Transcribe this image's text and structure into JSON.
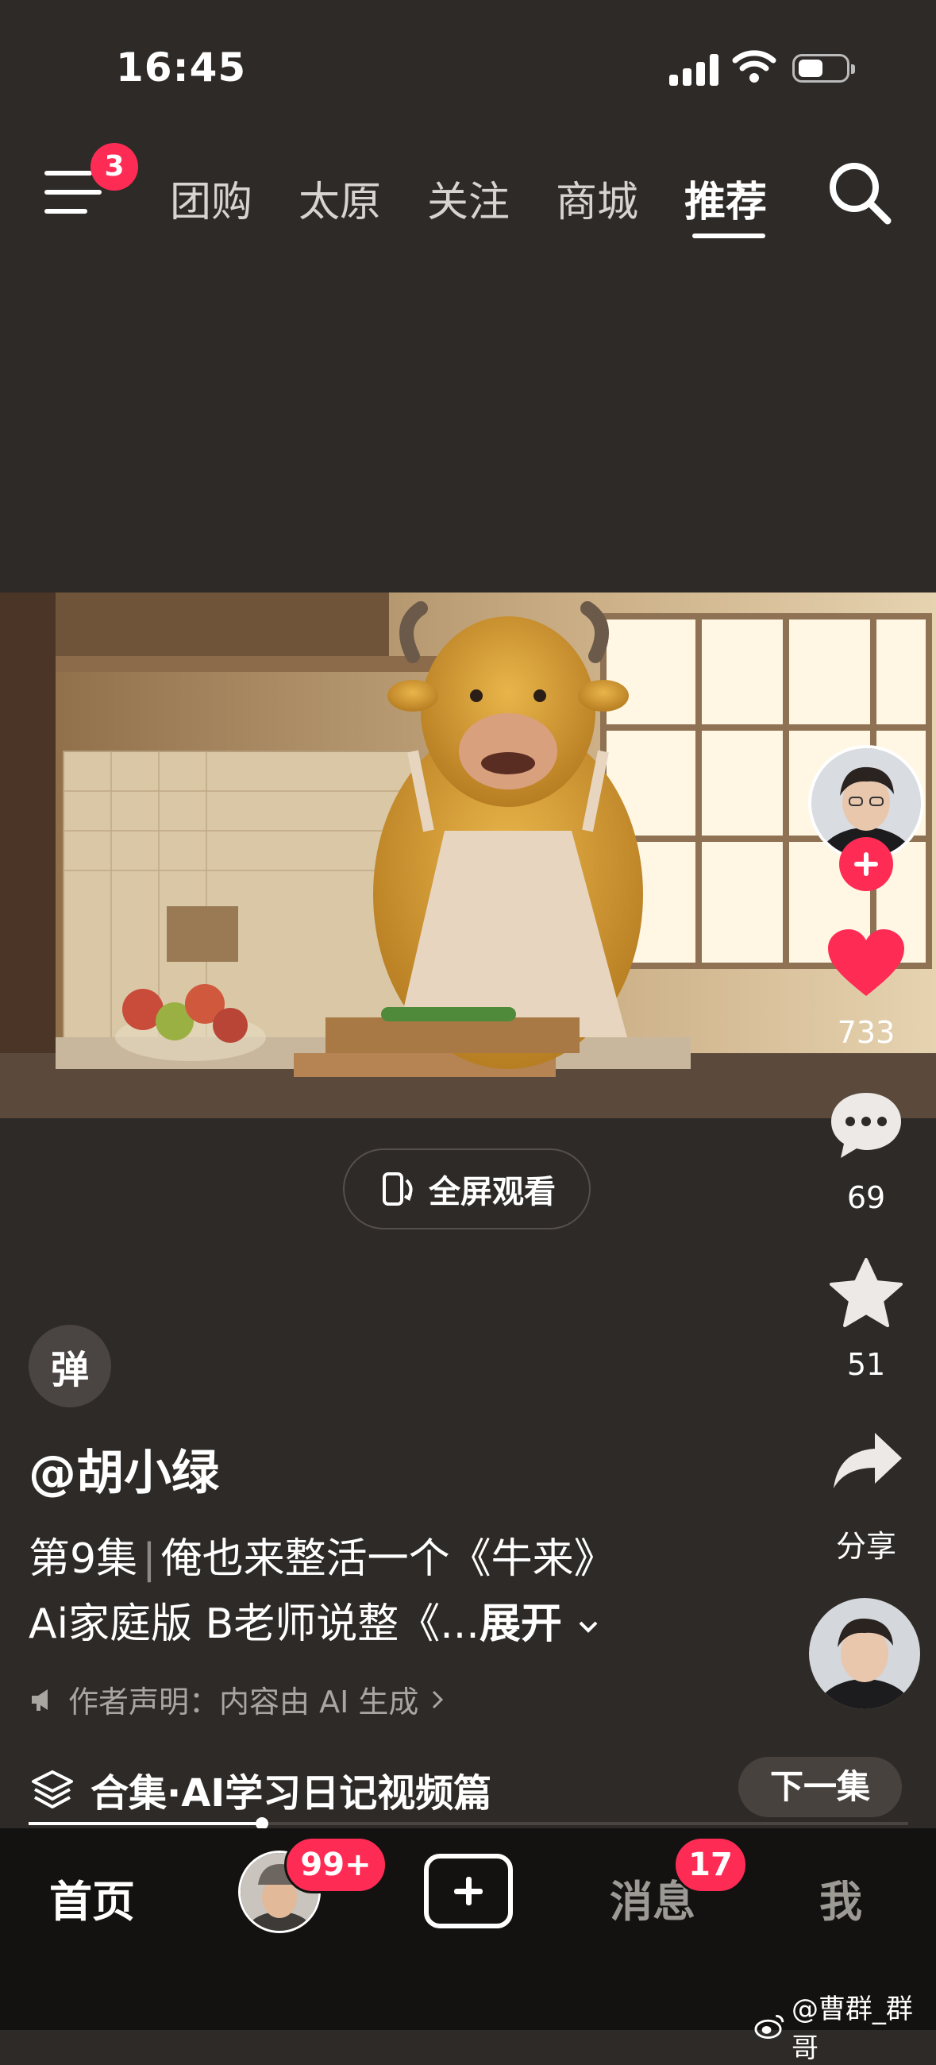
{
  "status_bar": {
    "time": "16:45"
  },
  "nav": {
    "menu_badge": "3",
    "tabs": [
      "团购",
      "太原",
      "关注",
      "商城",
      "推荐"
    ],
    "active_tab": "推荐"
  },
  "player": {
    "fullscreen_label": "全屏观看"
  },
  "actions": {
    "likes": "733",
    "comments": "69",
    "favorites": "51",
    "share_label": "分享"
  },
  "post": {
    "danmu_label": "弹",
    "author": "@胡小绿",
    "episode": "第9集",
    "desc_line1": "俺也来整活一个《牛来》",
    "desc_line2": "Ai家庭版 B老师说整《...",
    "expand": "展开",
    "statement": "作者声明：内容由 AI 生成",
    "collection": "合集·AI学习日记视频篇",
    "next_label": "下一集"
  },
  "tabbar": {
    "home": "首页",
    "friends_badge": "99+",
    "messages": "消息",
    "messages_badge": "17",
    "me": "我"
  },
  "watermark": "@曹群_群哥",
  "colors": {
    "accent": "#fe2c55",
    "background": "#2e2a27",
    "tabbar": "#141211"
  }
}
